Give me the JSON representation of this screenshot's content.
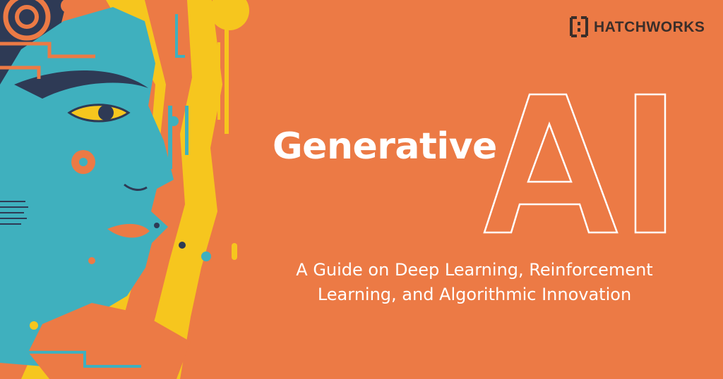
{
  "brand": {
    "name": "HATCHWORKS",
    "icon": "hatchworks-bracket-logo-icon"
  },
  "hero": {
    "headline": "Generative",
    "emphasis": "AI",
    "subtitle_line_1": "A Guide on Deep Learning, Reinforcement",
    "subtitle_line_2": "Learning, and Algorithmic Innovation"
  },
  "colors": {
    "background": "#ec7a45",
    "teal": "#3fb0be",
    "yellow": "#f6c61e",
    "navy": "#2e3a55",
    "white": "#ffffff",
    "logo_dark": "#3a2e2a"
  },
  "illustration": {
    "subject": "face-profile-circuit-illustration"
  }
}
